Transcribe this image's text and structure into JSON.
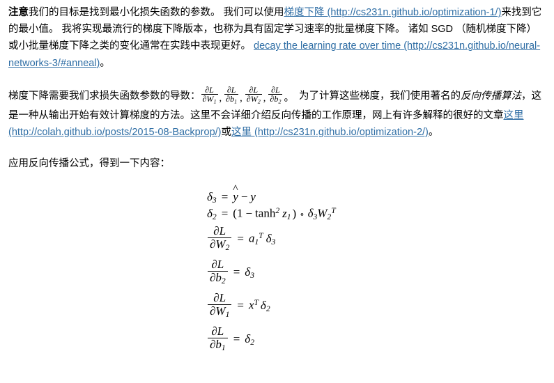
{
  "document": {
    "background_color": "#ffffff",
    "text_color": "#000000",
    "link_color": "#2f6ea5"
  },
  "paragraph1": {
    "bold_lead": "注意",
    "text_a": "我们的目标是找到最小化损失函数的参数。 我们可以使用",
    "link1": "梯度下降 (http://cs231n.github.io/optimization-1/)",
    "text_b": "来找到它的最小值。 我将实现最流行的梯度下降版本，也称为具有固定学习速率的批量梯度下降。 诸如 SGD （随机梯度下降）或小批量梯度下降之类的变化通常在实践中表现更好。 ",
    "link2": "decay the learning rate over time (http://cs231n.github.io/neural-networks-3/#anneal)",
    "text_c": "。"
  },
  "paragraph2": {
    "text_a": "梯度下降需要我们求损失函数参数的导数：",
    "derivatives": [
      {
        "numerator": "∂L",
        "denominator": "∂W",
        "denominator_sub": "1",
        "separator": ","
      },
      {
        "numerator": "∂L",
        "denominator": "∂b",
        "denominator_sub": "1",
        "separator": ","
      },
      {
        "numerator": "∂L",
        "denominator": "∂W",
        "denominator_sub": "2",
        "separator": ","
      },
      {
        "numerator": "∂L",
        "denominator": "∂b",
        "denominator_sub": "2",
        "separator": "。"
      }
    ],
    "text_b": " 为了计算这些梯度，我们使用著名的",
    "italic_term": "反向传播算法",
    "text_c": "，这是一种从输出开始有效计算梯度的方法。这里不会详细介绍反向传播的工作原理，网上有许多解释的很好的文章",
    "link1": "这里 (http://colah.github.io/posts/2015-08-Backprop/)",
    "text_d": "或",
    "link2": "这里 (http://cs231n.github.io/optimization-2/)",
    "text_e": "。"
  },
  "paragraph3": {
    "text": "应用反向传播公式，得到一下内容："
  },
  "equations": [
    {
      "id": "delta3",
      "lhs_symbol": "δ",
      "lhs_sub": "3",
      "equals": "=",
      "rhs": "ŷ − y",
      "rhs_plain": "y-hat minus y"
    },
    {
      "id": "delta2",
      "lhs_symbol": "δ",
      "lhs_sub": "2",
      "equals": "=",
      "rhs_plain": "(1 − tanh² z₁) ∘ δ₃W₂ᵀ",
      "open_paren": "(",
      "one": "1",
      "minus": "−",
      "tanh": "tanh",
      "tanh_sup": "2",
      "z": "z",
      "z_sub": "1",
      "close_paren": ")",
      "hadamard": "∘",
      "delta": "δ",
      "delta_sub": "3",
      "W": "W",
      "W_sub": "2",
      "W_sup": "T"
    },
    {
      "id": "dL-dW2",
      "num": "∂L",
      "den": "∂W",
      "den_sub": "2",
      "equals": "=",
      "rhs_base": "a",
      "rhs_sub": "1",
      "rhs_sup": "T",
      "rhs_delta": "δ",
      "rhs_delta_sub": "3",
      "rhs_plain": "a₁ᵀ δ₃"
    },
    {
      "id": "dL-db2",
      "num": "∂L",
      "den": "∂b",
      "den_sub": "2",
      "equals": "=",
      "rhs_delta": "δ",
      "rhs_delta_sub": "3",
      "rhs_plain": "δ₃"
    },
    {
      "id": "dL-dW1",
      "num": "∂L",
      "den": "∂W",
      "den_sub": "1",
      "equals": "=",
      "rhs_base": "x",
      "rhs_sup": "T",
      "rhs_delta": "δ",
      "rhs_delta_sub": "2",
      "rhs_plain": "xᵀ δ₂"
    },
    {
      "id": "dL-db1",
      "num": "∂L",
      "den": "∂b",
      "den_sub": "1",
      "equals": "=",
      "rhs_delta": "δ",
      "rhs_delta_sub": "2",
      "rhs_plain": "δ₂"
    }
  ]
}
